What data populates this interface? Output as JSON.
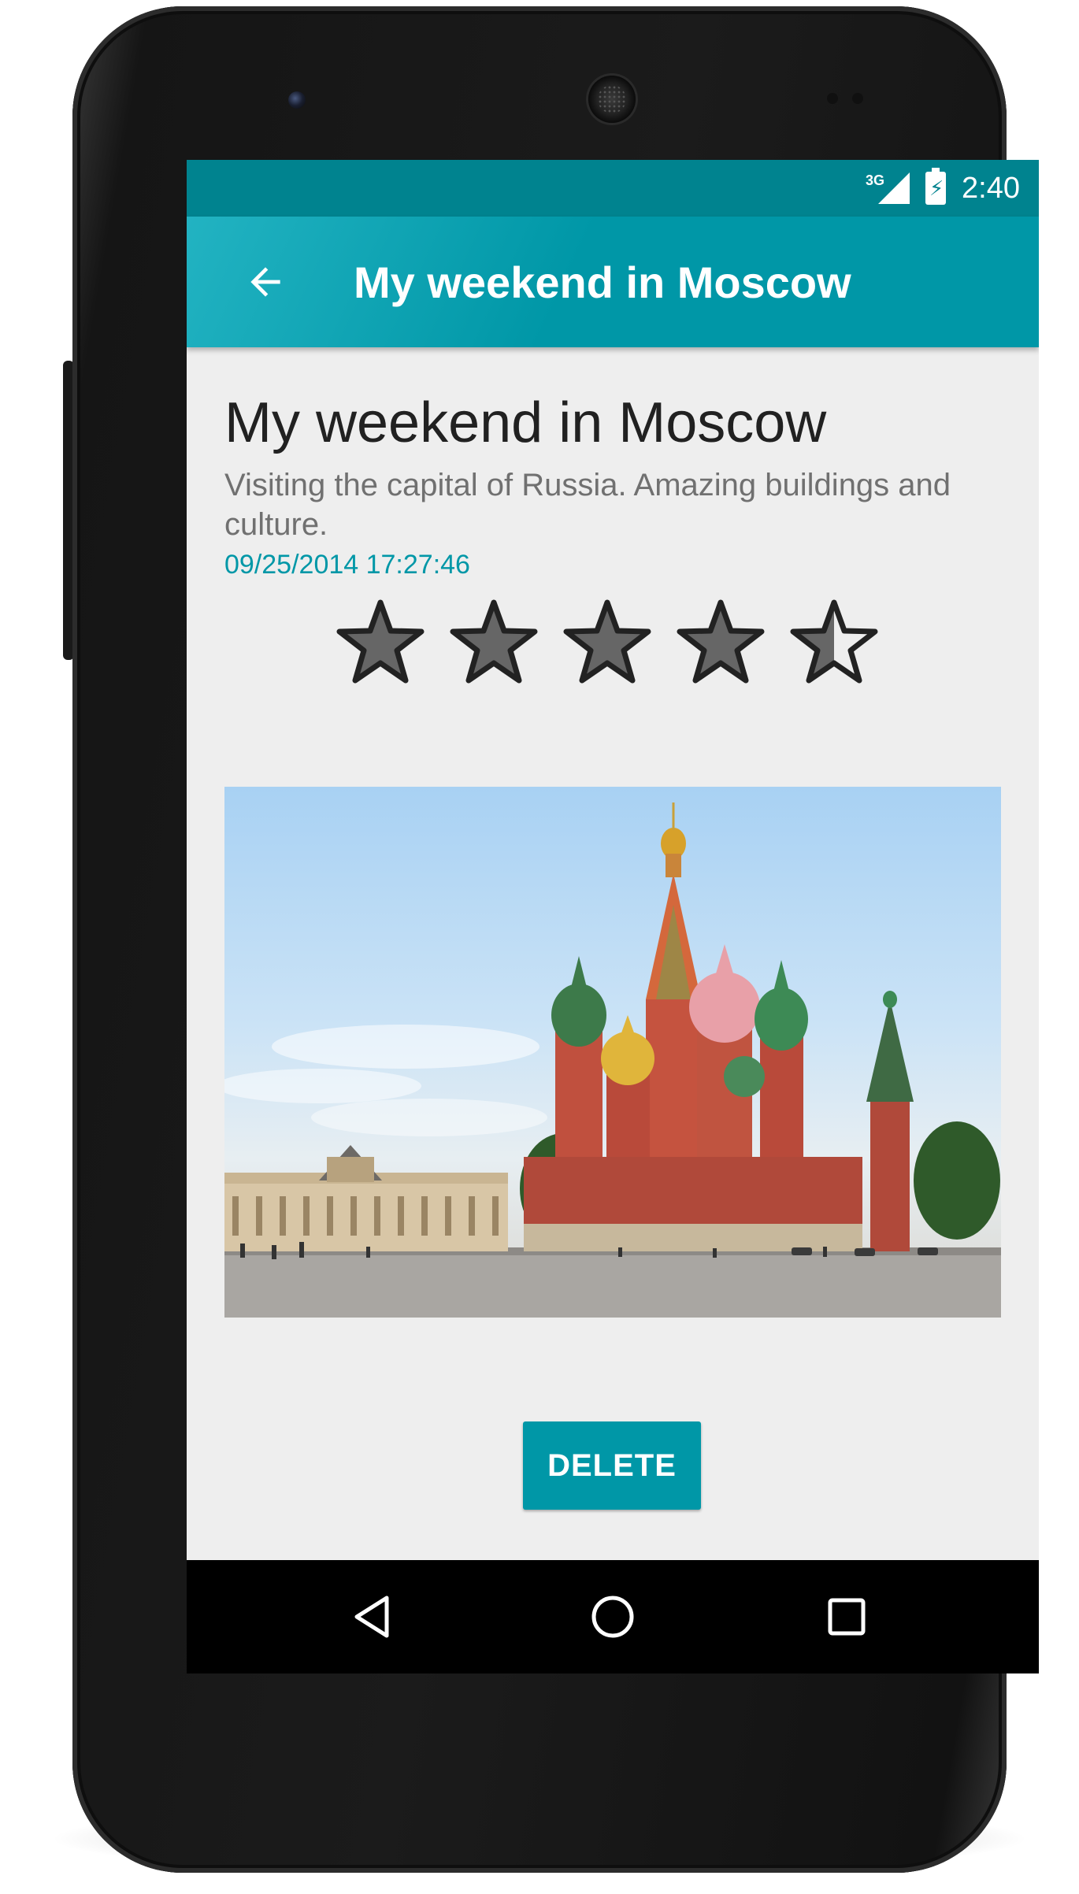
{
  "status_bar": {
    "network_type": "3G",
    "time": "2:40",
    "icons": [
      "signal-icon",
      "battery-charging-icon"
    ]
  },
  "app_bar": {
    "title": "My weekend in Moscow",
    "back_icon": "arrow-back-icon"
  },
  "entry": {
    "title": "My weekend in Moscow",
    "description": "Visiting the capital of Russia. Amazing buildings and culture.",
    "date": "09/25/2014 17:27:46",
    "rating": 4.5,
    "rating_max": 5
  },
  "photo": {
    "icon": "saint-basils-cathedral-photo"
  },
  "actions": {
    "delete_label": "DELETE"
  },
  "nav_bar": {
    "icons": [
      "nav-back-icon",
      "nav-home-icon",
      "nav-recent-icon"
    ]
  },
  "colors": {
    "primary": "#0097a7",
    "primary_dark": "#00838f",
    "background": "#eeeeee",
    "star_fill": "#666666"
  }
}
